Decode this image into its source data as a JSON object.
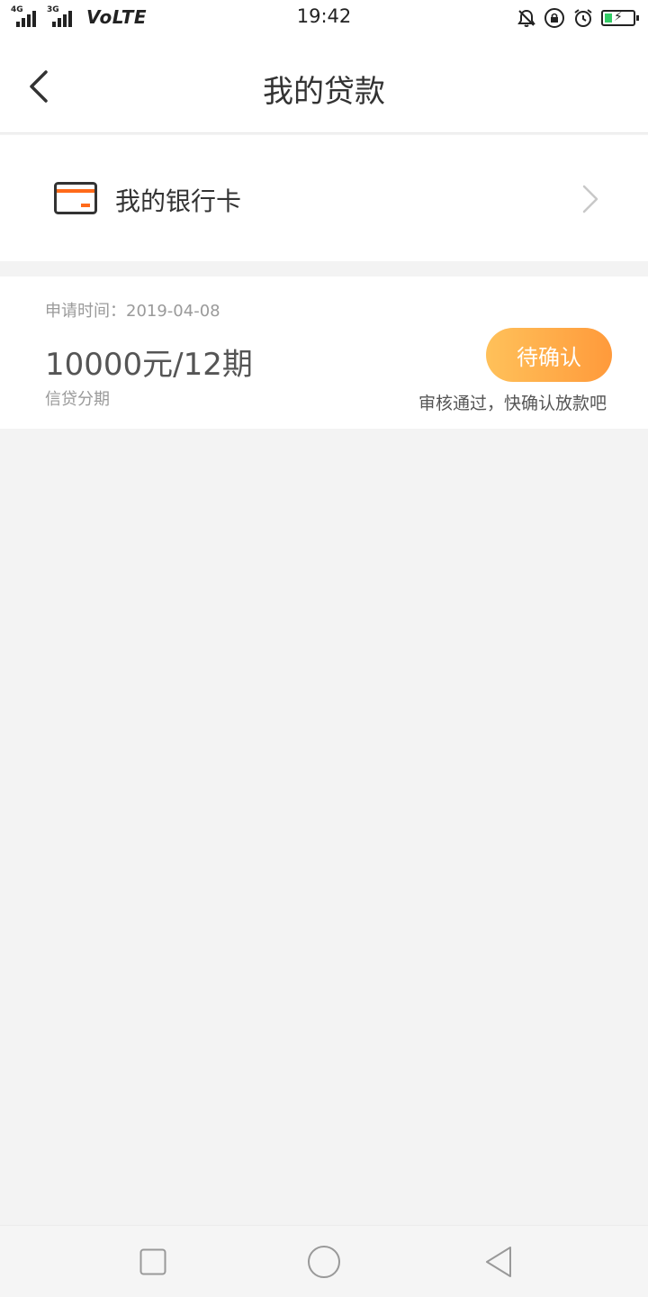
{
  "status_bar": {
    "network_1": "4G",
    "network_2": "3G",
    "volte": "VoLTE",
    "time": "19:42",
    "icons": [
      "bell-muted-icon",
      "rotation-lock-icon",
      "alarm-icon",
      "battery-charging-icon"
    ],
    "battery_level": 0.25,
    "battery_color": "#33cc66"
  },
  "header": {
    "back_icon": "chevron-left-icon",
    "title": "我的贷款"
  },
  "bank_card_row": {
    "icon": "bank-card-icon",
    "label": "我的银行卡",
    "chevron_icon": "chevron-right-icon",
    "accent_color": "#ff6a1a"
  },
  "loan": {
    "apply_time_label": "申请时间：",
    "apply_time_value": "2019-04-08",
    "amount_text": "10000元/12期",
    "type_label": "信贷分期",
    "status_button": "待确认",
    "status_note": "审核通过，快确认放款吧",
    "button_gradient": [
      "#ffc15a",
      "#ff9a3b"
    ]
  },
  "nav_bar": {
    "icons": [
      "recent-apps-icon",
      "home-icon",
      "back-triangle-icon"
    ]
  }
}
